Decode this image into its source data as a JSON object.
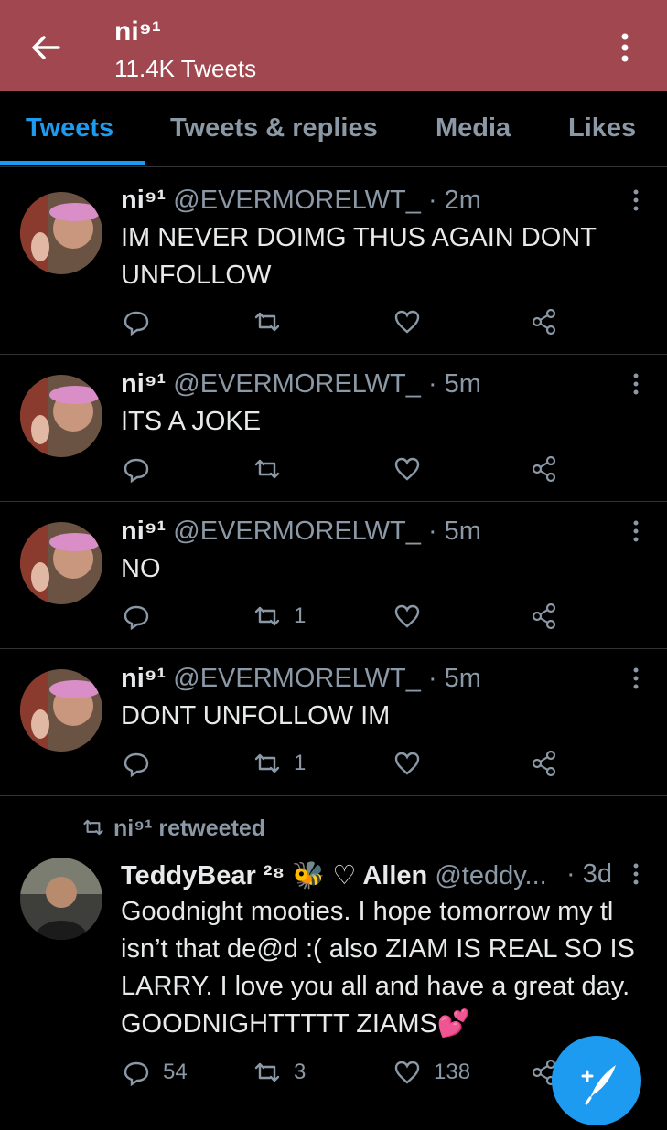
{
  "header": {
    "title": "ni⁹¹",
    "subtitle": "11.4K Tweets",
    "background": "#a0474f",
    "back_icon": "arrow-left-icon",
    "more_icon": "more-vertical-icon"
  },
  "tabs": [
    {
      "label": "Tweets",
      "active": true
    },
    {
      "label": "Tweets & replies",
      "active": false
    },
    {
      "label": "Media",
      "active": false
    },
    {
      "label": "Likes",
      "active": false
    }
  ],
  "accent": "#1d9bf0",
  "tweets": [
    {
      "name": "ni⁹¹",
      "handle": "@EVERMORELWT_",
      "time": "· 2m",
      "text": "IM NEVER DOIMG THUS AGAIN DONT UNFOLLOW",
      "retweets": "",
      "likes": "",
      "replies": ""
    },
    {
      "name": "ni⁹¹",
      "handle": "@EVERMORELWT_",
      "time": "· 5m",
      "text": "ITS A JOKE",
      "retweets": "",
      "likes": "",
      "replies": ""
    },
    {
      "name": "ni⁹¹",
      "handle": "@EVERMORELWT_",
      "time": "· 5m",
      "text": "NO",
      "retweets": "1",
      "likes": "",
      "replies": ""
    },
    {
      "name": "ni⁹¹",
      "handle": "@EVERMORELWT_",
      "time": "· 5m",
      "text": "DONT UNFOLLOW IM",
      "retweets": "1",
      "likes": "",
      "replies": ""
    }
  ],
  "retweet": {
    "label": "ni⁹¹ retweeted",
    "name": "TeddyBear ²⁸ 🐝 ♡ Allen",
    "handle": "@teddy...",
    "time": "· 3d",
    "text": "Goodnight mooties. I hope tomorrow my tl isn’t that de@d :( also ZIAM IS REAL SO IS LARRY. I love you all and have a great day. GOODNIGHTTTTT ZIAMS💕",
    "replies": "54",
    "retweets": "3",
    "likes": "138"
  },
  "fab_icon": "compose-feather-icon"
}
